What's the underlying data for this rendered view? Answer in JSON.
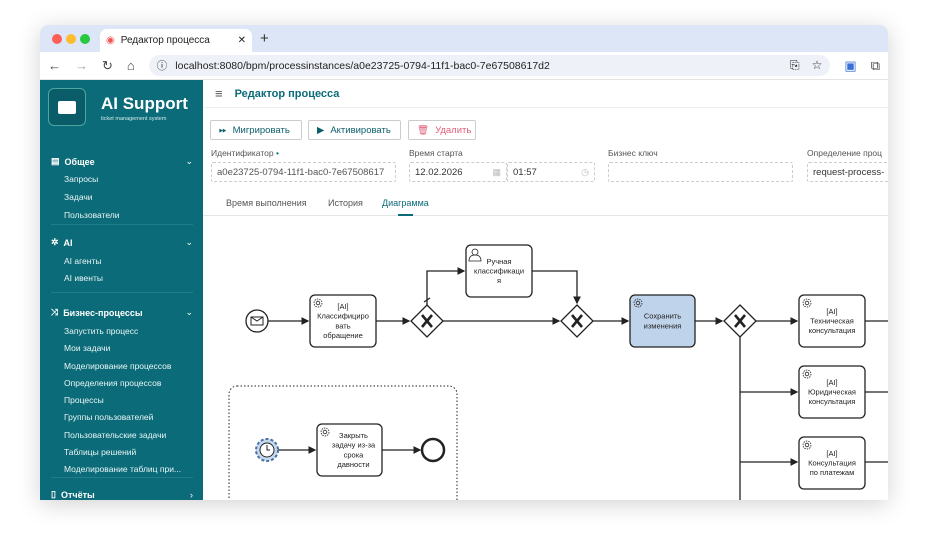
{
  "browser": {
    "tab_title": "Редактор процесса",
    "url": "localhost:8080/bpm/processinstances/a0e23725-0794-11f1-bac0-7e67508617d2"
  },
  "sidebar": {
    "brand": "AI Support",
    "subtitle": "ticket management system",
    "groups": [
      {
        "label": "Общее",
        "icon": "box-icon",
        "items": [
          "Запросы",
          "Задачи",
          "Пользователи"
        ]
      },
      {
        "label": "AI",
        "icon": "network-icon",
        "items": [
          "AI агенты",
          "AI ивенты"
        ]
      },
      {
        "label": "Бизнес-процессы",
        "icon": "shuffle-icon",
        "items": [
          "Запустить процесс",
          "Мои задачи",
          "Моделирование процессов",
          "Определения процессов",
          "Процессы",
          "Группы пользователей",
          "Пользовательские задачи",
          "Таблицы решений",
          "Моделирование таблиц при..."
        ]
      },
      {
        "label": "Отчёты",
        "icon": "document-icon",
        "items": []
      }
    ]
  },
  "header": {
    "title": "Редактор процесса"
  },
  "toolbar": {
    "migrate": "Мигрировать",
    "activate": "Активировать",
    "delete": "Удалить"
  },
  "form": {
    "id_label": "Идентификатор",
    "id_required": "•",
    "id_value": "a0e23725-0794-11f1-bac0-7e67508617",
    "start_label": "Время старта",
    "start_date": "12.02.2026",
    "start_time": "01:57",
    "key_label": "Бизнес ключ",
    "key_value": "",
    "def_label": "Определение проц",
    "def_value": "request-process-"
  },
  "tabs": [
    "Время выполнения",
    "История",
    "Диаграмма"
  ],
  "active_tab": "Диаграмма",
  "diagram": {
    "tasks": {
      "classify": [
        "[AI]",
        "Классифициро",
        "вать",
        "обращение"
      ],
      "manual": [
        "Ручная",
        "классификаци",
        "я"
      ],
      "save": [
        "Сохранить",
        "изменения"
      ],
      "tech": [
        "[AI]",
        "Техническая",
        "консультация"
      ],
      "legal": [
        "[AI]",
        "Юридическая",
        "консультация"
      ],
      "pay": [
        "[AI]",
        "Консультация",
        "по платежам"
      ],
      "close": [
        "Закрыть",
        "задачу из-за",
        "срока",
        "давности"
      ]
    },
    "highlight_color": "#bfd4ea"
  },
  "colors": {
    "sidebar": "#0b6b78",
    "accent": "#0b6b78",
    "danger": "#e0607a"
  }
}
